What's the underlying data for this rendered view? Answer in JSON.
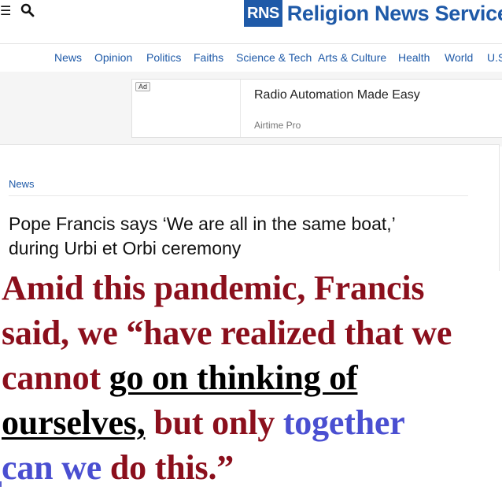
{
  "header": {
    "menu_icon": "hamburger-menu-icon",
    "search_icon": "search-icon",
    "logo_mark": "RNS",
    "logo_text": "Religion News Service"
  },
  "nav": {
    "items": [
      "News",
      "Opinion",
      "Politics",
      "Faiths",
      "Science & Tech",
      "Arts & Culture",
      "Health",
      "World",
      "U.S."
    ]
  },
  "ad": {
    "badge": "Ad",
    "title": "Radio Automation Made Easy",
    "sponsor": "Airtime Pro"
  },
  "article": {
    "section": "News",
    "headline_line1": "Pope Francis says ‘We are all in the same boat,’",
    "headline_line2": "during Urbi et Orbi ceremony"
  },
  "overlay_quote": {
    "line1": "Amid this pandemic, Francis",
    "line2": "said, we “have realized that we",
    "line3_a": "cannot ",
    "line3_b": "go on thinking of",
    "line4_a": "ourselves,",
    "line4_b": " but only ",
    "line4_c": "together",
    "line5_a": "can we ",
    "line5_b": "do this.”"
  },
  "colors": {
    "brand_blue": "#1f5aa8",
    "quote_red": "#8b0f1c",
    "quote_blue": "#4a4fd1"
  }
}
